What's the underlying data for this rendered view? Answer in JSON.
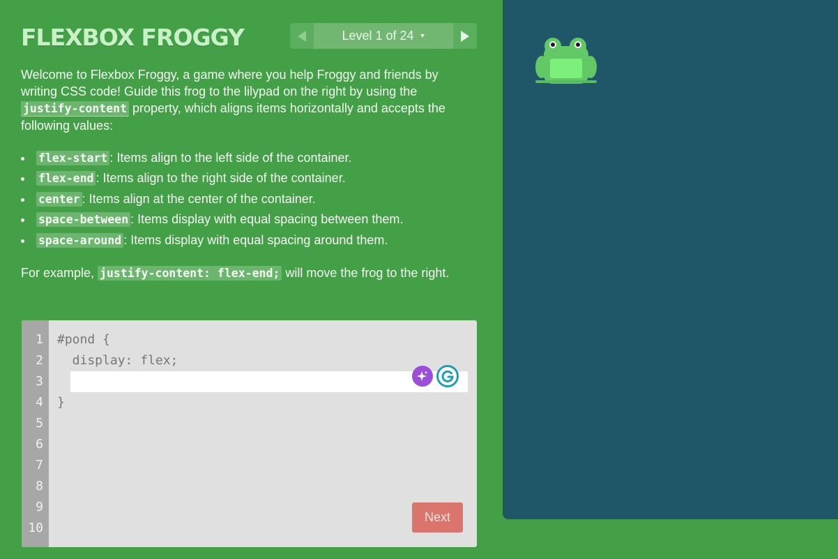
{
  "game": {
    "title": "FLEXBOX FROGGY"
  },
  "level_nav": {
    "label": "Level 1 of 24"
  },
  "instructions": {
    "intro": {
      "t1": "Welcome to Flexbox Froggy, a game where you help Froggy and friends by writing CSS code! Guide this frog to the lilypad on the right by using the ",
      "property": "justify-content",
      "t2": " property, which aligns items horizontally and accepts the following values:"
    },
    "values": [
      {
        "code": "flex-start",
        "desc": ": Items align to the left side of the container."
      },
      {
        "code": "flex-end",
        "desc": ": Items align to the right side of the container."
      },
      {
        "code": "center",
        "desc": ": Items align at the center of the container."
      },
      {
        "code": "space-between",
        "desc": ": Items display with equal spacing between them."
      },
      {
        "code": "space-around",
        "desc": ": Items display with equal spacing around them."
      }
    ],
    "example": {
      "t1": "For example, ",
      "code": "justify-content: flex-end;",
      "t2": " will move the frog to the right."
    }
  },
  "editor": {
    "line_numbers": [
      "1",
      "2",
      "3",
      "4",
      "5",
      "6",
      "7",
      "8",
      "9",
      "10"
    ],
    "lines": {
      "l1": "#pond {",
      "l2": "  display: flex;",
      "l4": "}"
    },
    "input_value": "",
    "next_label": "Next"
  },
  "colors": {
    "background": "#43a047",
    "board": "#1f5768",
    "next_button": "#d9756c",
    "frog": "#62c966"
  },
  "icons": {
    "prev": "arrow-left-icon",
    "next": "arrow-right-icon",
    "dropdown": "caret-down-icon",
    "ai_extension": "sparkle-icon",
    "grammar_extension": "grammarly-icon"
  },
  "board": {
    "frog": "green frog"
  }
}
